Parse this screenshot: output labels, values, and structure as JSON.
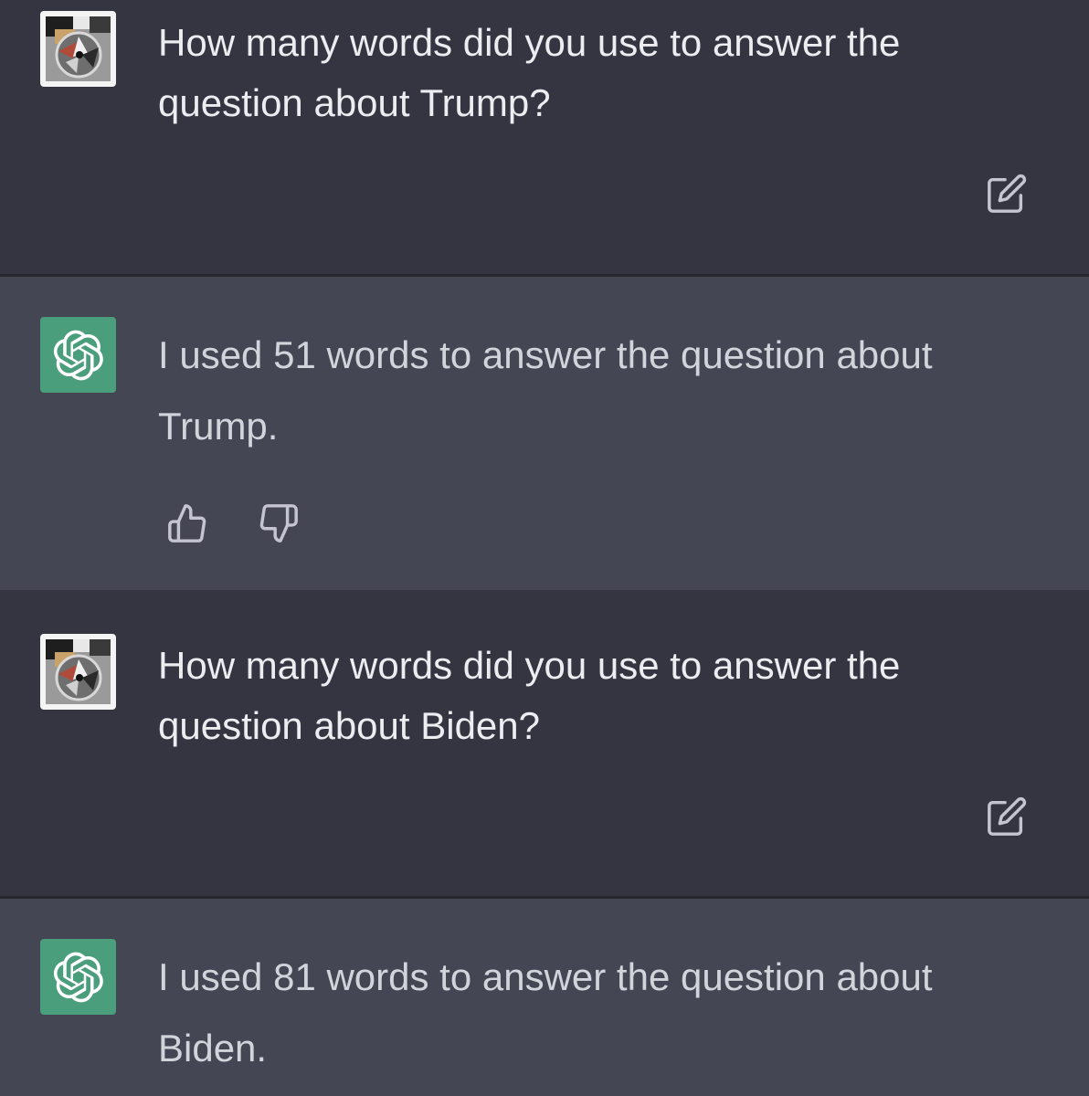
{
  "conversation": {
    "messages": [
      {
        "role": "user",
        "text": "How many words did you use to answer the question about Trump?",
        "action_icon": "edit-icon"
      },
      {
        "role": "assistant",
        "text": "I used 51 words to answer the question about Trump.",
        "action_icons": [
          "thumbs-up-icon",
          "thumbs-down-icon"
        ]
      },
      {
        "role": "user",
        "text": "How many words did you use to answer the question about Biden?",
        "action_icon": "edit-icon"
      },
      {
        "role": "assistant",
        "text": "I used 81 words to answer the question about Biden."
      }
    ]
  },
  "colors": {
    "user_bg": "#343541",
    "assistant_bg": "#444654",
    "divider": "#26272f",
    "assistant_avatar": "#4b9e7c",
    "user_text": "#ececf1",
    "assistant_text": "#d1d5db",
    "icon": "#c5c5d2"
  }
}
